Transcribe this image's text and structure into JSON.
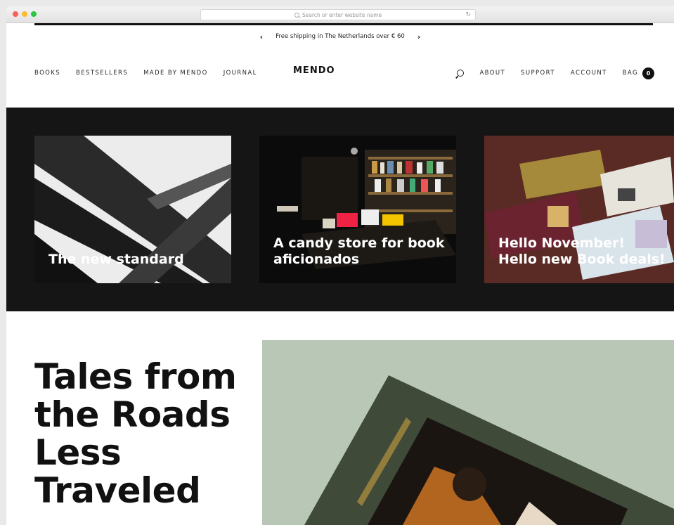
{
  "browser": {
    "url_placeholder": "Search or enter website name"
  },
  "promo": {
    "text": "Free shipping in The Netherlands over € 60"
  },
  "nav": {
    "left": [
      "BOOKS",
      "BESTSELLERS",
      "MADE BY MENDO",
      "JOURNAL"
    ],
    "brand": "MENDO",
    "right": [
      "ABOUT",
      "SUPPORT",
      "ACCOUNT"
    ],
    "bag_label": "BAG",
    "bag_count": "0"
  },
  "features": [
    {
      "caption": "The new standard"
    },
    {
      "caption": "A candy store for book aficionados"
    },
    {
      "caption": "Hello November! Hello new Book deals!"
    }
  ],
  "hero": {
    "headline": "Tales from the Roads Less Traveled"
  },
  "colors": {
    "band": "#151515",
    "accent": "#111111",
    "hero_bg": "#b9c8b6"
  }
}
